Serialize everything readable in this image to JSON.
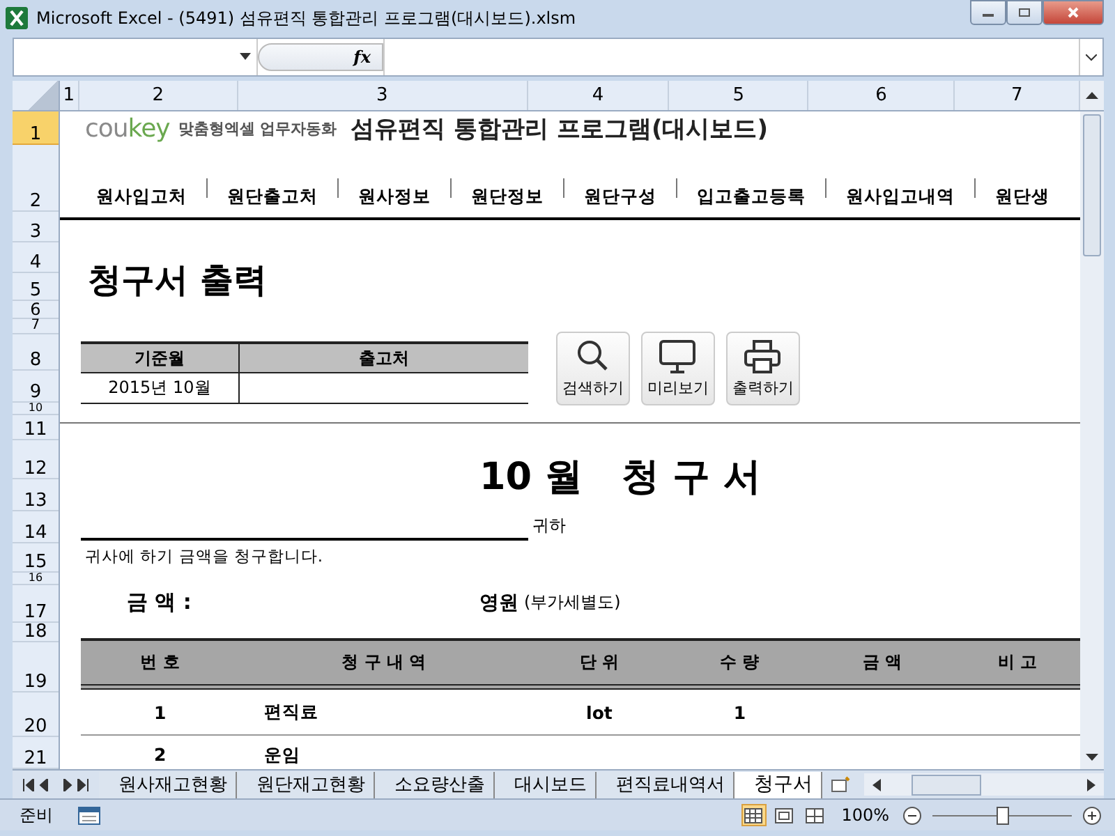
{
  "window": {
    "title": "Microsoft Excel - (5491) 섬유편직 통합관리 프로그램(대시보드).xlsm"
  },
  "formula_bar": {
    "function_label": "fx"
  },
  "columns": [
    {
      "label": "1"
    },
    {
      "label": "2"
    },
    {
      "label": "3"
    },
    {
      "label": "4"
    },
    {
      "label": "5"
    },
    {
      "label": "6"
    },
    {
      "label": "7"
    }
  ],
  "rows": [
    {
      "label": "1",
      "selected": true
    },
    {
      "label": "2",
      "selected": false
    },
    {
      "label": "3",
      "selected": false
    },
    {
      "label": "4",
      "selected": false
    },
    {
      "label": "5",
      "selected": false
    },
    {
      "label": "6",
      "selected": false
    },
    {
      "label": "7",
      "selected": false
    },
    {
      "label": "8",
      "selected": false
    },
    {
      "label": "9",
      "selected": false
    },
    {
      "label": "10",
      "selected": false
    },
    {
      "label": "11",
      "selected": false
    },
    {
      "label": "12",
      "selected": false
    },
    {
      "label": "13",
      "selected": false
    },
    {
      "label": "14",
      "selected": false
    },
    {
      "label": "15",
      "selected": false
    },
    {
      "label": "16",
      "selected": false
    },
    {
      "label": "17",
      "selected": false
    },
    {
      "label": "18",
      "selected": false
    },
    {
      "label": "19",
      "selected": false
    },
    {
      "label": "20",
      "selected": false
    },
    {
      "label": "21",
      "selected": false
    }
  ],
  "brand": {
    "logo_cou": "cou",
    "logo_key": "key",
    "tagline": "맞춤형엑셀 업무자동화",
    "title": "섬유편직 통합관리 프로그램(대시보드)"
  },
  "nav": [
    "원사입고처",
    "원단출고처",
    "원사정보",
    "원단정보",
    "원단구성",
    "입고출고등록",
    "원사입고내역",
    "원단생"
  ],
  "page_heading": "청구서 출력",
  "filter": {
    "columns": [
      "기준월",
      "출고처"
    ],
    "month": "2015년 10월"
  },
  "buttons": [
    {
      "label": "검색하기",
      "kind": "search"
    },
    {
      "label": "미리보기",
      "kind": "monitor"
    },
    {
      "label": "출력하기",
      "kind": "printer"
    }
  ],
  "invoice": {
    "title": "10 월   청 구 서",
    "recipient_suffix": "귀하",
    "notice": "귀사에 하기 금액을 청구합니다.",
    "amount_label": "금 액 :",
    "amount_unit": "영원",
    "vat_note": "(부가세별도)",
    "table": {
      "columns": [
        "번 호",
        "청 구 내 역",
        "단 위",
        "수 량",
        "금 액",
        "비 고"
      ],
      "rows": [
        [
          "1",
          "편직료",
          "lot",
          "1"
        ],
        [
          "2",
          "운임"
        ]
      ]
    }
  },
  "sheet_tabs": [
    {
      "label": "원사재고현황",
      "selected": false
    },
    {
      "label": "원단재고현황",
      "selected": false
    },
    {
      "label": "소요량산출",
      "selected": false
    },
    {
      "label": "대시보드",
      "selected": false
    },
    {
      "label": "편직료내역서",
      "selected": false
    },
    {
      "label": "청구서",
      "selected": true
    }
  ],
  "status_bar": {
    "mode": "준비",
    "zoom": "100%",
    "level": 0.5,
    "views": [
      {
        "kind": "normal",
        "selected": true
      },
      {
        "kind": "page_layout",
        "selected": false
      },
      {
        "kind": "page_break",
        "selected": false
      }
    ]
  }
}
